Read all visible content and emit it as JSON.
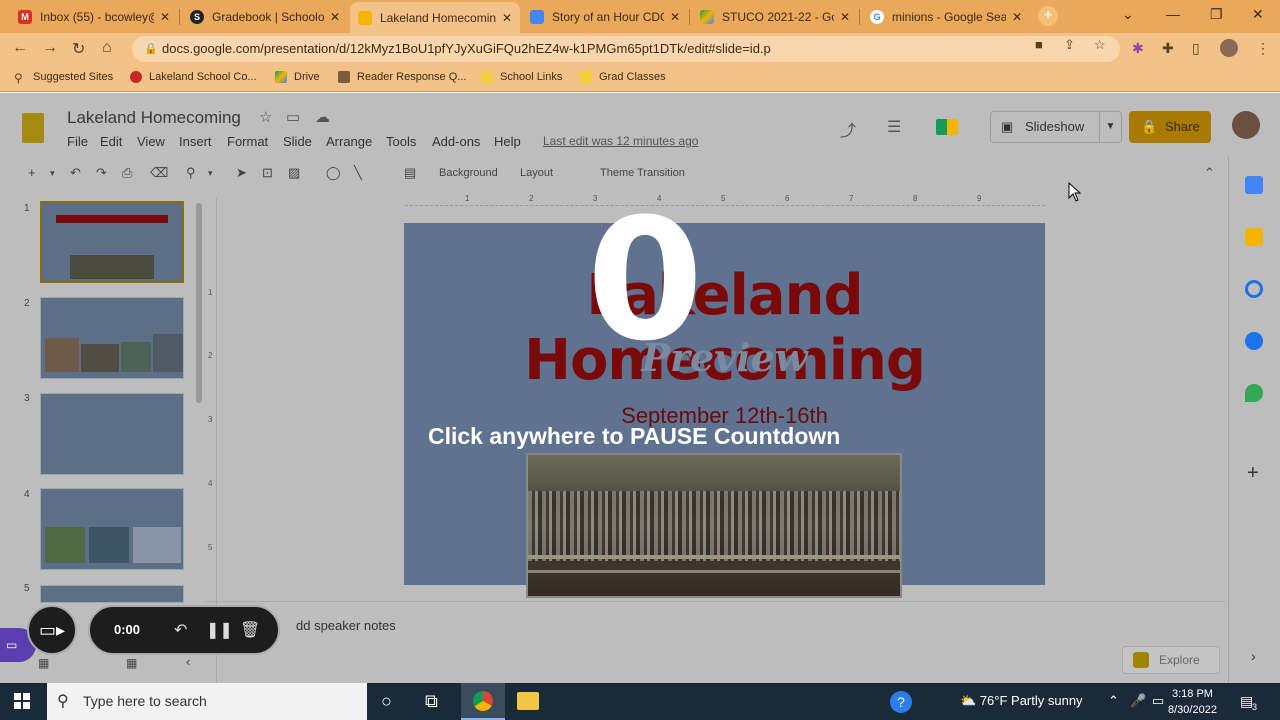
{
  "browser": {
    "tabs": [
      {
        "title": "Inbox (55) - bcowley@",
        "favicon": "gmail-icon",
        "color": "#d93025",
        "glyph": "M"
      },
      {
        "title": "Gradebook | Schoolog",
        "favicon": "schoology-icon",
        "color": "#222222",
        "glyph": "S"
      },
      {
        "title": "Lakeland Homecomin",
        "favicon": "slides-icon",
        "color": "#f4b400",
        "glyph": ""
      },
      {
        "title": "Story of an Hour CDC",
        "favicon": "docs-icon",
        "color": "#4285f4",
        "glyph": ""
      },
      {
        "title": "STUCO 2021-22 - Goc",
        "favicon": "drive-icon",
        "color": "#0f9d58",
        "glyph": ""
      },
      {
        "title": "minions - Google Sea",
        "favicon": "google-icon",
        "color": "#4285f4",
        "glyph": "G"
      }
    ],
    "url": "docs.google.com/presentation/d/12kMyz1BoU1pfYJyXuGiFQu2hEZ4w-k1PMGm65pt1DTk/edit#slide=id.p",
    "bookmarks": [
      {
        "label": "Suggested Sites",
        "icon": "suggested-sites-icon",
        "color": "#5a3f1c"
      },
      {
        "label": "Lakeland School Co...",
        "icon": "lakeland-school-icon",
        "color": "#c62828"
      },
      {
        "label": "Drive",
        "icon": "drive-icon",
        "color": "#0f9d58"
      },
      {
        "label": "Reader Response Q...",
        "icon": "reader-response-icon",
        "color": "#7b5b3a"
      },
      {
        "label": "School Links",
        "icon": "folder-icon",
        "color": "#f4d03f"
      },
      {
        "label": "Grad Classes",
        "icon": "folder-icon",
        "color": "#f4d03f"
      }
    ]
  },
  "app": {
    "title": "Lakeland Homecoming",
    "menus": [
      "File",
      "Edit",
      "View",
      "Insert",
      "Format",
      "Slide",
      "Arrange",
      "Tools",
      "Add-ons",
      "Help"
    ],
    "last_edit": "Last edit was 12 minutes ago",
    "slideshow_label": "Slideshow",
    "share_label": "Share",
    "toolbar_text": [
      "Background",
      "Layout",
      "Theme",
      "Transition"
    ],
    "ruler_marks": [
      "1",
      "2",
      "3",
      "4",
      "5",
      "6",
      "7",
      "8",
      "9"
    ],
    "vruler_marks": [
      "1",
      "2",
      "3",
      "4",
      "5"
    ],
    "slide_numbers": [
      "1",
      "2",
      "3",
      "4",
      "5"
    ],
    "speaker_notes_placeholder": "dd speaker notes",
    "explore_label": "Explore"
  },
  "slide": {
    "title": "Lakeland Homecoming",
    "subtitle": "Preview",
    "date": "September 12th-16th"
  },
  "overlay": {
    "countdown": "0",
    "message": "Click anywhere to PAUSE Countdown"
  },
  "recorder": {
    "time": "0:00"
  },
  "taskbar": {
    "search_placeholder": "Type here to search",
    "weather": "76°F  Partly sunny",
    "time": "3:18 PM",
    "date": "8/30/2022",
    "notification_count": "3"
  }
}
